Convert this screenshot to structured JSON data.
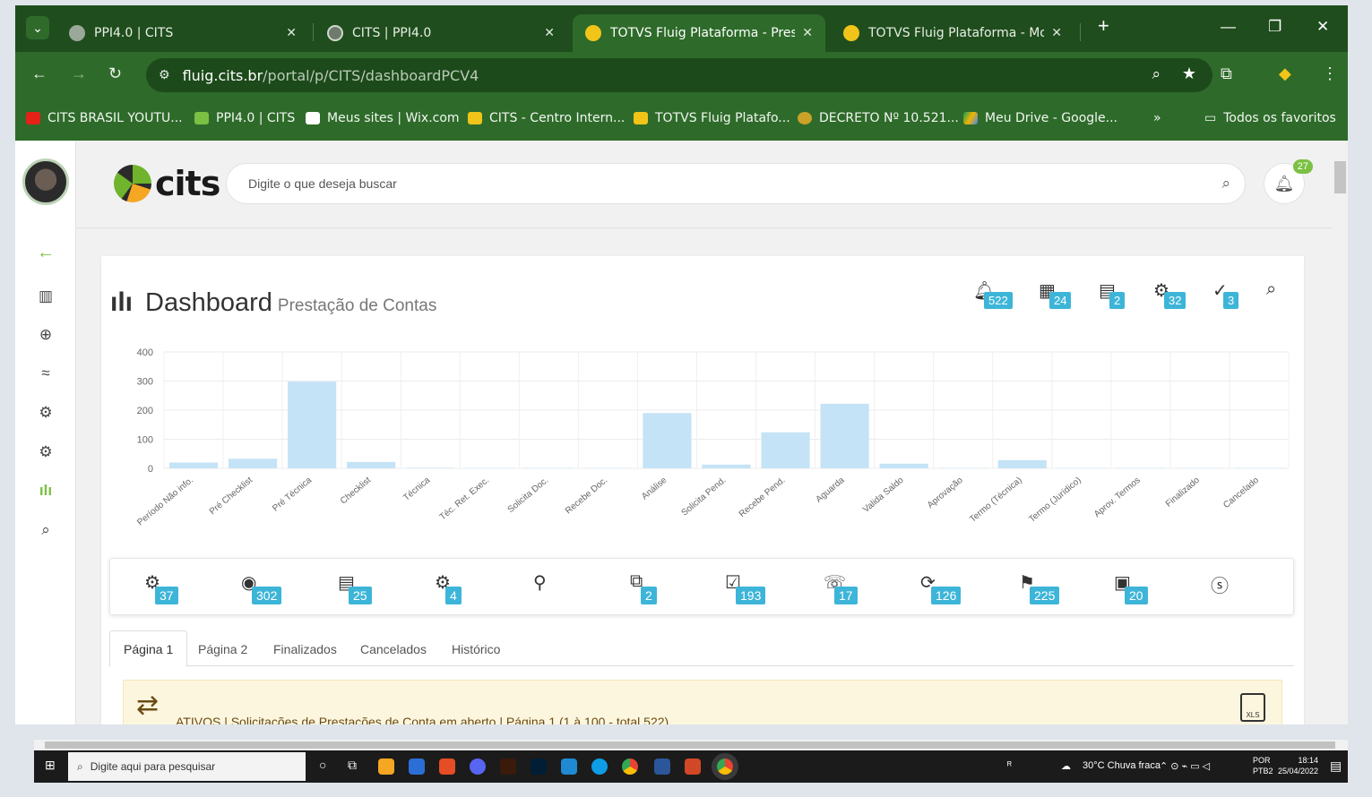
{
  "browser": {
    "tabs": [
      {
        "title": "PPI4.0 | CITS",
        "active": false
      },
      {
        "title": "CITS | PPI4.0",
        "active": false
      },
      {
        "title": "TOTVS Fluig Plataforma - Presta",
        "active": true
      },
      {
        "title": "TOTVS Fluig Plataforma - Movir",
        "active": false
      }
    ],
    "new_tab": "+",
    "url_host": "fluig.cits.br",
    "url_path": "/portal/p/CITS/dashboardPCV4",
    "bookmarks": [
      "CITS BRASIL YOUTU...",
      "PPI4.0 | CITS",
      "Meus sites | Wix.com",
      "CITS - Centro Intern...",
      "TOTVS Fluig Platafo...",
      "DECRETO Nº 10.521...",
      "Meu Drive - Google..."
    ],
    "bookmarks_more": "»",
    "all_bookmarks": "Todos os favoritos"
  },
  "header": {
    "logo_text": "cits",
    "search_placeholder": "Digite o que deseja buscar",
    "notif_count": "27"
  },
  "dashboard": {
    "title": "Dashboard",
    "subtitle": "Prestação de Contas",
    "top_icons": [
      {
        "icon": "bell-icon",
        "count": "522"
      },
      {
        "icon": "calendar-icon",
        "count": "24"
      },
      {
        "icon": "folder-share-icon",
        "count": "2"
      },
      {
        "icon": "doc-gear-icon",
        "count": "32"
      },
      {
        "icon": "doc-check-icon",
        "count": "3"
      },
      {
        "icon": "doc-search-icon",
        "count": ""
      }
    ],
    "status_icons": [
      {
        "icon": "doc-settings-icon",
        "count": "37"
      },
      {
        "icon": "eye-icon",
        "count": "302"
      },
      {
        "icon": "documents-icon",
        "count": "25"
      },
      {
        "icon": "eye-gear-icon",
        "count": "4"
      },
      {
        "icon": "user-link-icon",
        "count": ""
      },
      {
        "icon": "copy-icon",
        "count": "2"
      },
      {
        "icon": "user-approval-icon",
        "count": "193"
      },
      {
        "icon": "phone-icon",
        "count": "17"
      },
      {
        "icon": "refresh-doc-icon",
        "count": "126"
      },
      {
        "icon": "flag-icon",
        "count": "225"
      },
      {
        "icon": "invoice-icon",
        "count": "20"
      },
      {
        "icon": "dollar-icon",
        "count": ""
      }
    ],
    "tabs": [
      "Página 1",
      "Página 2",
      "Finalizados",
      "Cancelados",
      "Histórico"
    ],
    "alert_text": "ATIVOS | Solicitações de Prestações de Conta em aberto | Página 1 (1 à 100 - total 522)",
    "xls_label": "XLS"
  },
  "chart_data": {
    "type": "bar",
    "categories": [
      "Período Não info.",
      "Pré Checklist",
      "Pré Técnica",
      "Checklist",
      "Técnica",
      "Téc. Ret. Exec.",
      "Solicita Doc.",
      "Recebe Doc.",
      "Análise",
      "Solicita Pend.",
      "Recebe Pend.",
      "Aguarda",
      "Valida Saldo",
      "Aprovação",
      "Termo (Técnica)",
      "Termo (Jurídico)",
      "Aprov. Termos",
      "Finalizado",
      "Cancelado"
    ],
    "values": [
      20,
      33,
      298,
      22,
      2,
      1,
      1,
      1,
      190,
      13,
      124,
      222,
      16,
      1,
      28,
      1,
      1,
      1,
      1
    ],
    "y_ticks": [
      "0",
      "100",
      "200",
      "300",
      "400"
    ],
    "ylim": [
      0,
      400
    ],
    "color": "#c5e3f6",
    "grid": true
  },
  "taskbar": {
    "search_placeholder": "Digite aqui para pesquisar",
    "weather": "30°C  Chuva fraca",
    "lang": "POR",
    "lang2": "PTB2",
    "time": "18:14",
    "date": "25/04/2022"
  }
}
